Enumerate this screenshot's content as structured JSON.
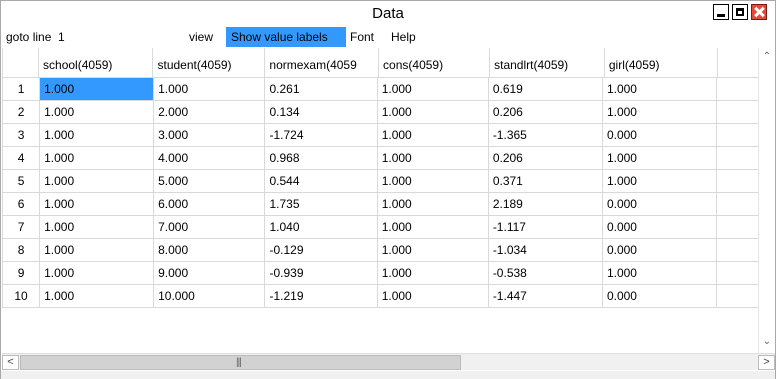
{
  "window": {
    "title": "Data"
  },
  "menu": {
    "goto_label": "goto line",
    "goto_value": "1",
    "view": "view",
    "show_value_labels": "Show value labels",
    "font": "Font",
    "help": "Help"
  },
  "columns": [
    "school(4059)",
    "student(4059)",
    "normexam(4059",
    "cons(4059)",
    "standlrt(4059)",
    "girl(4059)"
  ],
  "rows": [
    {
      "n": "1",
      "cells": [
        "1.000",
        "1.000",
        "0.261",
        "1.000",
        "0.619",
        "1.000"
      ]
    },
    {
      "n": "2",
      "cells": [
        "1.000",
        "2.000",
        "0.134",
        "1.000",
        "0.206",
        "1.000"
      ]
    },
    {
      "n": "3",
      "cells": [
        "1.000",
        "3.000",
        "-1.724",
        "1.000",
        "-1.365",
        "0.000"
      ]
    },
    {
      "n": "4",
      "cells": [
        "1.000",
        "4.000",
        "0.968",
        "1.000",
        "0.206",
        "1.000"
      ]
    },
    {
      "n": "5",
      "cells": [
        "1.000",
        "5.000",
        "0.544",
        "1.000",
        "0.371",
        "1.000"
      ]
    },
    {
      "n": "6",
      "cells": [
        "1.000",
        "6.000",
        "1.735",
        "1.000",
        "2.189",
        "0.000"
      ]
    },
    {
      "n": "7",
      "cells": [
        "1.000",
        "7.000",
        "1.040",
        "1.000",
        "-1.117",
        "0.000"
      ]
    },
    {
      "n": "8",
      "cells": [
        "1.000",
        "8.000",
        "-0.129",
        "1.000",
        "-1.034",
        "0.000"
      ]
    },
    {
      "n": "9",
      "cells": [
        "1.000",
        "9.000",
        "-0.939",
        "1.000",
        "-0.538",
        "1.000"
      ]
    },
    {
      "n": "10",
      "cells": [
        "1.000",
        "10.000",
        "-1.219",
        "1.000",
        "-1.447",
        "0.000"
      ]
    }
  ],
  "colors": {
    "selection": "#3399ff",
    "close": "#e24b3c"
  },
  "icons": {
    "minimize": "minimize-icon",
    "maximize": "maximize-icon",
    "close": "close-icon",
    "scroll_up": "chevron-up-icon",
    "scroll_down": "chevron-down-icon",
    "scroll_left": "chevron-left-icon",
    "scroll_right": "chevron-right-icon"
  }
}
